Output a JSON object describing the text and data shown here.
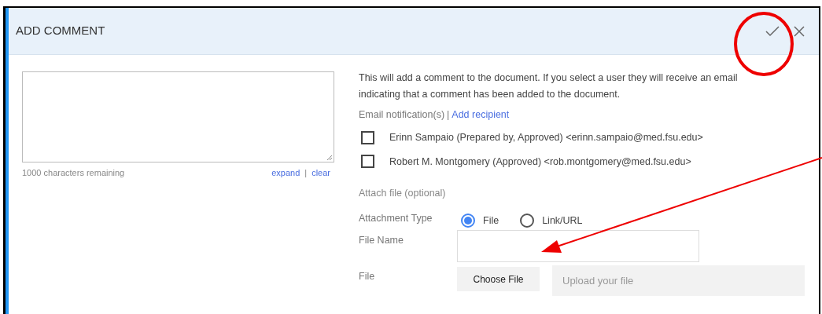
{
  "dialog": {
    "title": "ADD COMMENT"
  },
  "comment": {
    "remaining": "1000 characters remaining",
    "links": [
      "expand",
      "clear"
    ],
    "separator": "|"
  },
  "info": "This will add a comment to the document. If you select a user they will receive an email indicating that a comment has been added to the document.",
  "notifications": {
    "label": "Email notification(s)",
    "separator": "|",
    "add_link": "Add recipient"
  },
  "recipients": [
    {
      "label": "Erinn Sampaio (Prepared by, Approved) <erinn.sampaio@med.fsu.edu>",
      "checked": false
    },
    {
      "label": "Robert M. Montgomery (Approved) <rob.montgomery@med.fsu.edu>",
      "checked": false
    }
  ],
  "attach": {
    "heading": "Attach file (optional)",
    "type_label": "Attachment Type",
    "types": [
      {
        "label": "File",
        "selected": true
      },
      {
        "label": "Link/URL",
        "selected": false
      }
    ],
    "file_name_label": "File Name",
    "file_label": "File",
    "choose_button": "Choose File",
    "upload_placeholder": "Upload your file"
  }
}
